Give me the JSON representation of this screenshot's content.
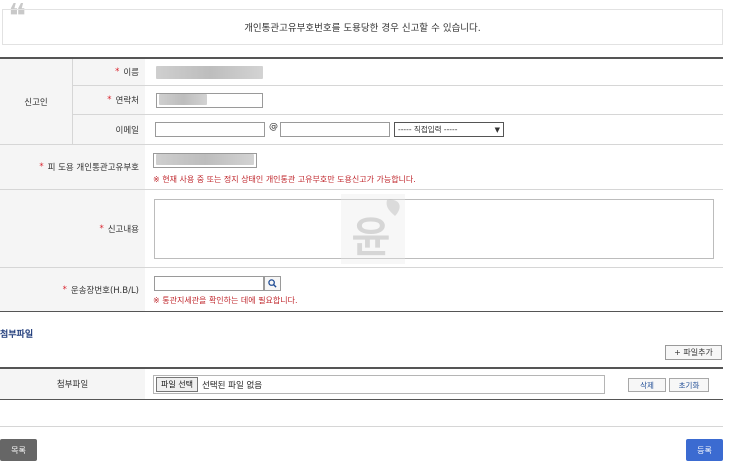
{
  "notice": {
    "text": "개인통관고유부호번호를 도용당한 경우 신고할 수 있습니다."
  },
  "reporter": {
    "group_label": "신고인",
    "name_label": "이름",
    "contact_label": "연락처",
    "email_label": "이메일",
    "email_at": "@",
    "email_domain_select": "----- 직접입력 -----"
  },
  "stolen_code": {
    "label": "피 도용 개인통관고유부호",
    "warning": "※ 현재 사용 중 또는 정지 상태인 개인통관 고유부호만 도용신고가 가능합니다."
  },
  "report_content": {
    "label": "신고내용"
  },
  "waybill": {
    "label": "운송장번호(H.B/L)",
    "warning": "※ 통관지세관을 확인하는 데에 필요합니다."
  },
  "attachments": {
    "section_title": "첨부파일",
    "add_button": "+ 파일추가",
    "row_label": "첨부파일",
    "choose_button": "파일 선택",
    "status_text": "선택된 파일 없음",
    "delete_button": "삭제",
    "reset_button": "초기화"
  },
  "actions": {
    "list_button": "목록",
    "submit_button": "등록"
  },
  "colors": {
    "required_star": "#d9232d",
    "warning_text": "#c0282e",
    "submit_bg": "#3b6bd1",
    "list_bg": "#666666",
    "section_title": "#1f3b7a"
  },
  "watermark": {
    "glyph": "윤"
  }
}
